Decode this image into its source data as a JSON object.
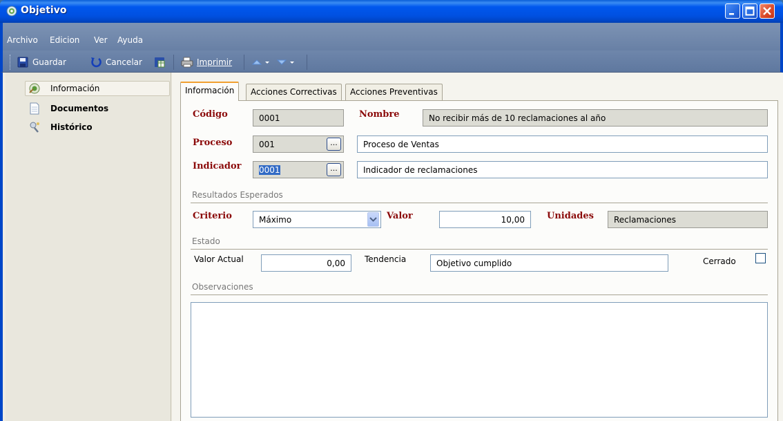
{
  "window": {
    "title": "Objetivo"
  },
  "menu": [
    "Archivo",
    "Edicion",
    "Ver",
    "Ayuda"
  ],
  "toolbar": {
    "save": "Guardar",
    "cancel": "Cancelar",
    "print": "Imprimir"
  },
  "sidebar": {
    "items": [
      {
        "label": "Información",
        "icon": "info-icon"
      },
      {
        "label": "Documentos",
        "icon": "document-icon"
      },
      {
        "label": "Histórico",
        "icon": "history-icon"
      }
    ]
  },
  "tabs": [
    "Información",
    "Acciones Correctivas",
    "Acciones Preventivas"
  ],
  "form": {
    "codigo_label": "Código",
    "codigo_value": "0001",
    "nombre_label": "Nombre",
    "nombre_value": "No recibir más de 10 reclamaciones al año",
    "proceso_label": "Proceso",
    "proceso_code": "001",
    "proceso_name": "Proceso de Ventas",
    "indicador_label": "Indicador",
    "indicador_code": "0001",
    "indicador_name": "Indicador de reclamaciones",
    "lookup_button": "...",
    "resultados_section": "Resultados Esperados",
    "criterio_label": "Criterio",
    "criterio_value": "Máximo",
    "valor_label": "Valor",
    "valor_value": "10,00",
    "unidades_label": "Unidades",
    "unidades_value": "Reclamaciones",
    "estado_section": "Estado",
    "valor_actual_label": "Valor Actual",
    "valor_actual_value": "0,00",
    "tendencia_label": "Tendencia",
    "tendencia_value": "Objetivo cumplido",
    "cerrado_label": "Cerrado",
    "observaciones_section": "Observaciones",
    "observaciones_value": ""
  },
  "colors": {
    "title_bar": "#0058ee",
    "required_label": "#8b0a0a",
    "active_tab_accent": "#f0a030",
    "selection": "#316ac5"
  }
}
